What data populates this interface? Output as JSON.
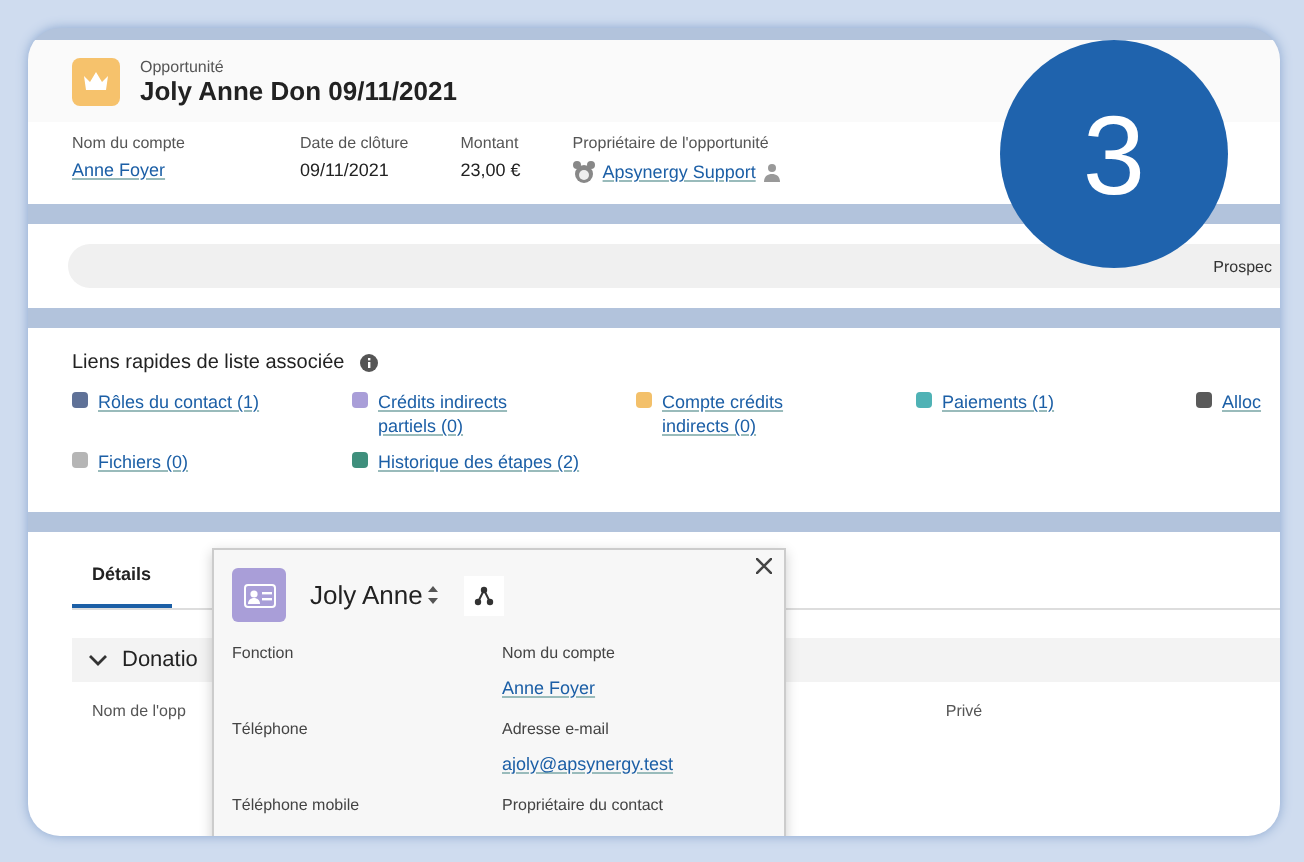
{
  "record": {
    "object_type": "Opportunité",
    "title": "Joly Anne Don 09/11/2021"
  },
  "highlights": [
    {
      "label": "Nom du compte",
      "value": "Anne Foyer",
      "kind": "link"
    },
    {
      "label": "Date de clôture",
      "value": "09/11/2021",
      "kind": "text"
    },
    {
      "label": "Montant",
      "value": "23,00 €",
      "kind": "text"
    },
    {
      "label": "Propriétaire de l'opportunité",
      "value": "Apsynergy Support",
      "kind": "user"
    }
  ],
  "path": {
    "stage": "Prospec"
  },
  "related_lists": {
    "title": "Liens rapides de liste associée",
    "links": [
      {
        "label": "Rôles du contact (1)",
        "color": "#5f7197"
      },
      {
        "label": "Crédits indirects partiels (0)",
        "color": "#a99ed8"
      },
      {
        "label": "Compte crédits indirects (0)",
        "color": "#f3c06a"
      },
      {
        "label": "Paiements (1)",
        "color": "#4fb2b5"
      },
      {
        "label": "Alloc",
        "color": "#5a5a5a"
      },
      {
        "label": "Fichiers (0)",
        "color": "#b5b5b5"
      },
      {
        "label": "Historique des étapes (2)",
        "color": "#3f8f7c"
      }
    ]
  },
  "tabs": [
    {
      "label": "Détails",
      "selected": true
    }
  ],
  "section": {
    "title": "Donatio",
    "expanded": true
  },
  "field_labels": [
    "Nom de l'opp",
    "Privé"
  ],
  "popover": {
    "title": "Joly Anne",
    "fields": [
      {
        "label": "Fonction"
      },
      {
        "label": "Nom du compte",
        "value": "Anne Foyer"
      },
      {
        "label": "Téléphone"
      },
      {
        "label": "Adresse e-mail",
        "value": "ajoly@apsynergy.test"
      },
      {
        "label": "Téléphone mobile"
      },
      {
        "label": "Propriétaire du contact"
      }
    ]
  },
  "step_badge": "3"
}
